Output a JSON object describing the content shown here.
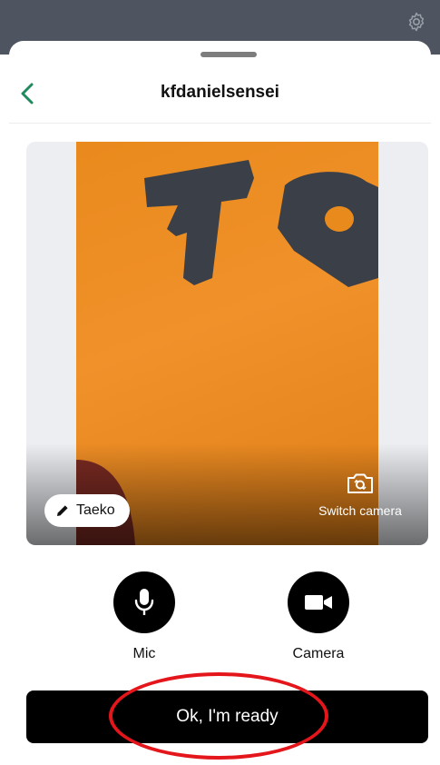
{
  "header": {
    "title": "kfdanielsensei"
  },
  "preview": {
    "participant_name": "Taeko",
    "switch_camera_label": "Switch camera"
  },
  "controls": {
    "mic_label": "Mic",
    "camera_label": "Camera"
  },
  "ready_button": {
    "label": "Ok, I'm ready"
  },
  "colors": {
    "accent_green": "#1f8a5b",
    "annotation_red": "#e4161b",
    "button_black": "#000000"
  }
}
